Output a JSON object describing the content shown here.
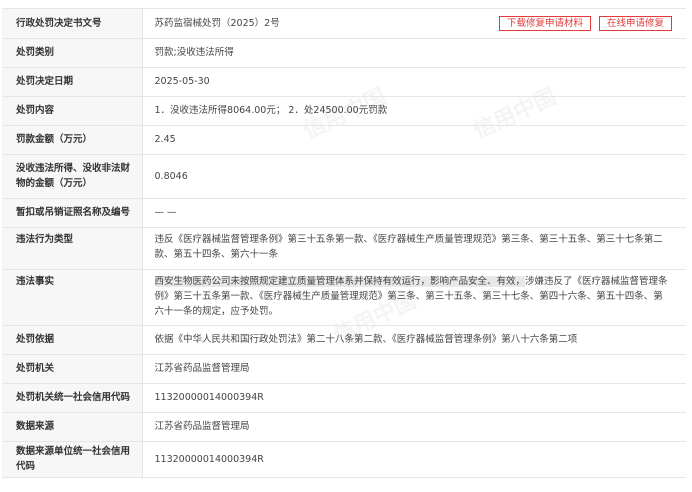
{
  "rows": [
    {
      "label": "行政处罚决定书文号",
      "value": "苏药监宿械处罚（2025）2号"
    },
    {
      "label": "处罚类别",
      "value": "罚款;没收违法所得"
    },
    {
      "label": "处罚决定日期",
      "value": "2025-05-30"
    },
    {
      "label": "处罚内容",
      "value": "1．没收违法所得8064.00元；  2．处24500.00元罚款"
    },
    {
      "label": "罚款金额（万元）",
      "value": "2.45"
    },
    {
      "label": "没收违法所得、没收非法财物的金额（万元）",
      "value": "0.8046"
    },
    {
      "label": "暂扣或吊销证照名称及编号",
      "value": "— —"
    },
    {
      "label": "违法行为类型",
      "value": "违反《医疗器械监督管理条例》第三十五条第一款、《医疗器械生产质量管理规范》第三条、第三十五条、第三十七条第二款、第五十四条、第六十一条"
    },
    {
      "label": "违法事实",
      "value_highlight": "西安生物医药公司未按照规定建立质量管理体系并保持有效运行，影响产品安全、有效，",
      "value_rest": "涉嫌违反了《医疗器械监督管理条例》第三十五条第一款、《医疗器械生产质量管理规范》第三条、第三十五条、第三十七条、第四十六条、第五十四条、第六十一条的规定，应予处罚。"
    },
    {
      "label": "处罚依据",
      "value": "依据《中华人民共和国行政处罚法》第二十八条第二款、《医疗器械监督管理条例》第八十六条第二项"
    },
    {
      "label": "处罚机关",
      "value": "江苏省药品监督管理局"
    },
    {
      "label": "处罚机关统一社会信用代码",
      "value": "11320000014000394R"
    },
    {
      "label": "数据来源",
      "value": "江苏省药品监督管理局"
    },
    {
      "label": "数据来源单位统一社会信用代码",
      "value": "11320000014000394R"
    }
  ],
  "buttons": {
    "download": "下载修复申请材料",
    "online": "在线申请修复"
  },
  "watermark": "信用中国",
  "colors": {
    "accent": "#e23b3b",
    "label_bg": "#f7f7f7",
    "border": "#e6e6e6"
  }
}
